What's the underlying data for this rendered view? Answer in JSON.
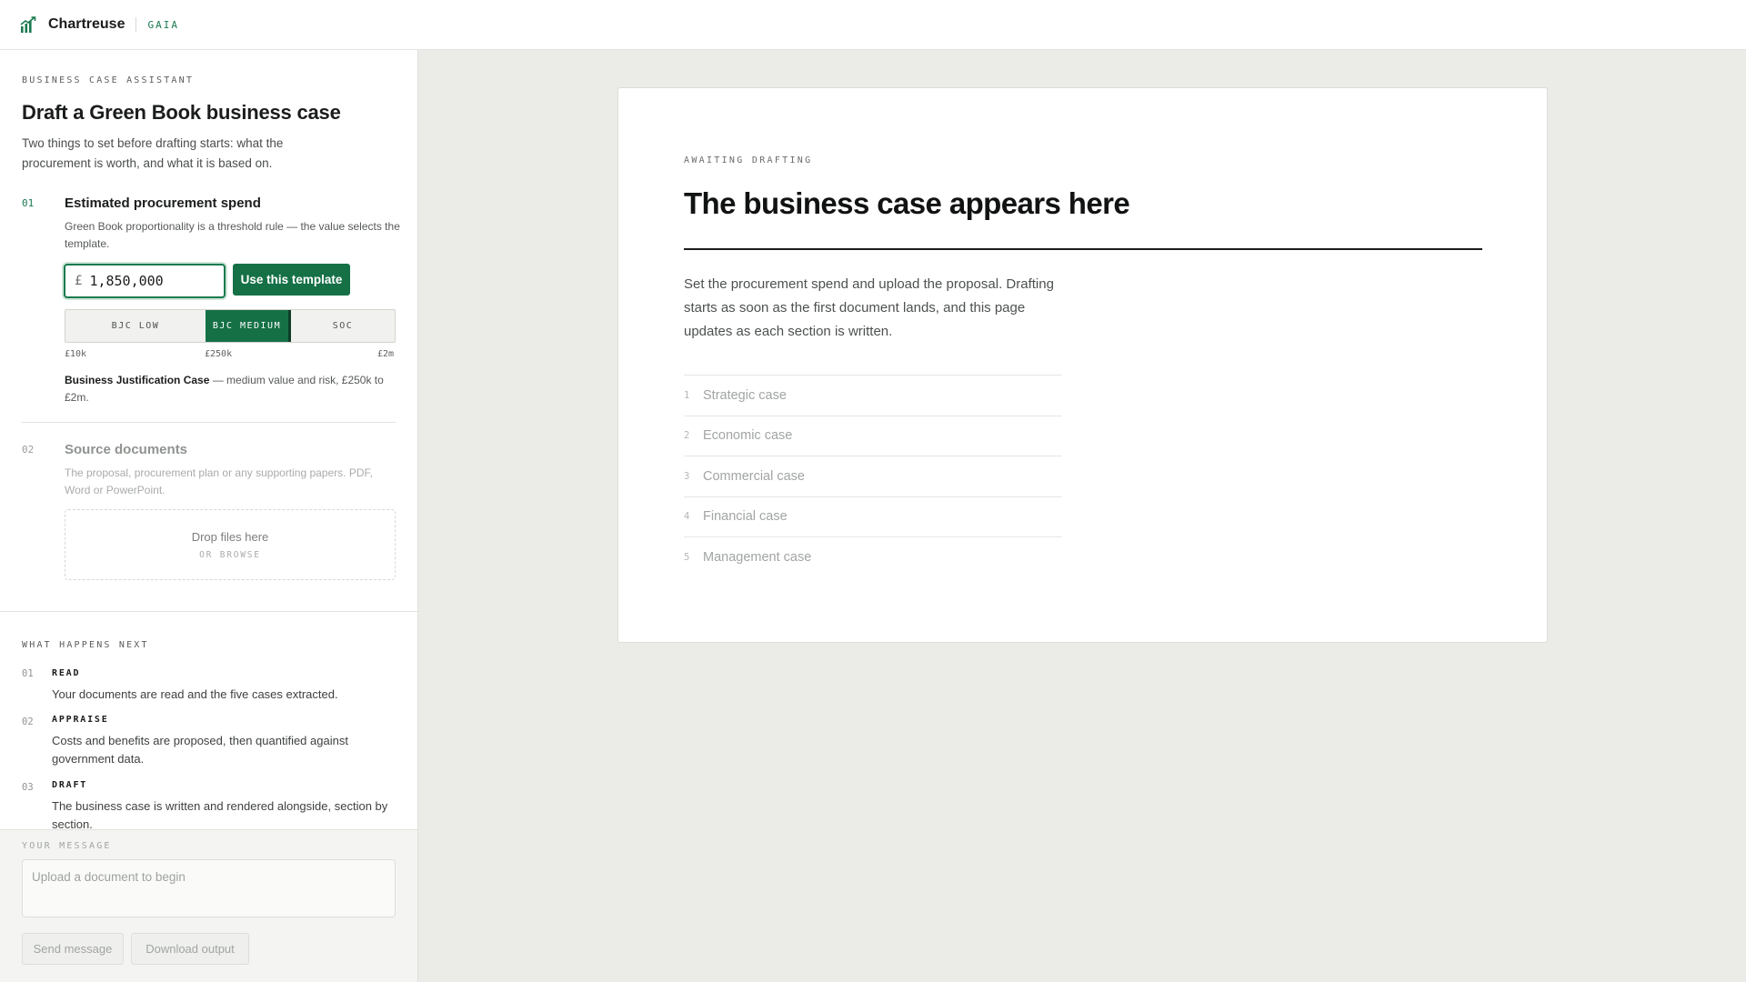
{
  "app": {
    "name": "Chartreuse",
    "tag": "GAIA"
  },
  "panel": {
    "eyebrow": "BUSINESS CASE ASSISTANT",
    "title": "Draft a Green Book business case",
    "intro": "Two things to set before drafting starts: what the procurement is worth, and what it is based on."
  },
  "step1": {
    "num": "01",
    "title": "Estimated procurement spend",
    "desc": "Green Book proportionality is a threshold rule — the value selects the template.",
    "currency": "£",
    "value": "1,850,000",
    "button": "Use this template",
    "segments": [
      "BJC LOW",
      "BJC MEDIUM",
      "SOC"
    ],
    "selected_segment": "BJC MEDIUM",
    "ticks": [
      "£10k",
      "£250k",
      "£2m"
    ],
    "template_name": "Business Justification Case",
    "template_desc": " — medium value and risk, £250k to £2m."
  },
  "step2": {
    "num": "02",
    "title": "Source documents",
    "desc": "The proposal, procurement plan or any supporting papers. PDF, Word or PowerPoint.",
    "drop_title": "Drop files here",
    "drop_sub": "OR BROWSE"
  },
  "next": {
    "eyebrow": "WHAT HAPPENS NEXT",
    "items": [
      {
        "num": "01",
        "head": "READ",
        "body": "Your documents are read and the five cases extracted."
      },
      {
        "num": "02",
        "head": "APPRAISE",
        "body": "Costs and benefits are proposed, then quantified against government data."
      },
      {
        "num": "03",
        "head": "DRAFT",
        "body": "The business case is written and rendered alongside, section by section."
      }
    ]
  },
  "composer": {
    "label": "YOUR MESSAGE",
    "placeholder": "Upload a document to begin",
    "send": "Send message",
    "download": "Download output"
  },
  "document": {
    "eyebrow": "AWAITING DRAFTING",
    "title": "The business case appears here",
    "body": "Set the procurement spend and upload the proposal. Drafting starts as soon as the first document lands, and this page updates as each section is written.",
    "sections": [
      {
        "num": "1",
        "label": "Strategic case"
      },
      {
        "num": "2",
        "label": "Economic case"
      },
      {
        "num": "3",
        "label": "Commercial case"
      },
      {
        "num": "4",
        "label": "Financial case"
      },
      {
        "num": "5",
        "label": "Management case"
      }
    ]
  },
  "colors": {
    "accent": "#157046",
    "background": "#ebece8"
  }
}
